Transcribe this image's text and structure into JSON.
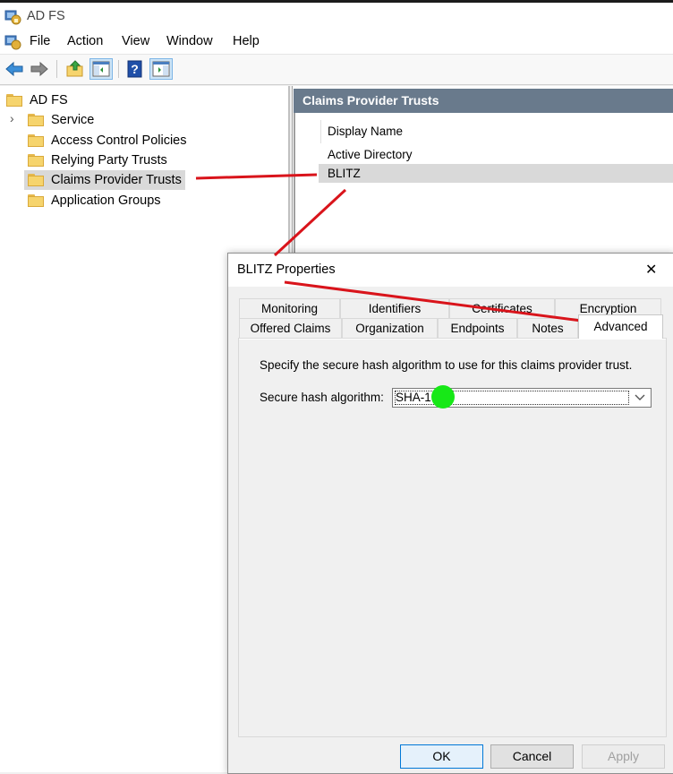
{
  "app": {
    "title": "AD FS"
  },
  "menu": {
    "items": [
      "File",
      "Action",
      "View",
      "Window",
      "Help"
    ]
  },
  "tree": {
    "root": "AD FS",
    "children": [
      "Service",
      "Access Control Policies",
      "Relying Party Trusts",
      "Claims Provider Trusts",
      "Application Groups"
    ],
    "selected": "Claims Provider Trusts"
  },
  "right_pane": {
    "header": "Claims Provider Trusts",
    "column_header": "Display Name",
    "rows": [
      "Active Directory",
      "BLITZ"
    ]
  },
  "dialog": {
    "title": "BLITZ Properties",
    "close_glyph": "✕",
    "tabs_row1": [
      "Monitoring",
      "Identifiers",
      "Certificates",
      "Encryption"
    ],
    "tabs_row2": [
      "Offered Claims",
      "Organization",
      "Endpoints",
      "Notes",
      "Advanced"
    ],
    "active_tab": "Advanced",
    "description": "Specify the secure hash algorithm to use for this claims provider trust.",
    "hash_label": "Secure hash algorithm:",
    "hash_value": "SHA-1",
    "buttons": {
      "ok": "OK",
      "cancel": "Cancel",
      "apply": "Apply"
    }
  },
  "colors": {
    "pane_header": "#697a8c",
    "annotation_line": "#d9141b",
    "marker": "#17e817",
    "selection": "#d9d9d9"
  }
}
